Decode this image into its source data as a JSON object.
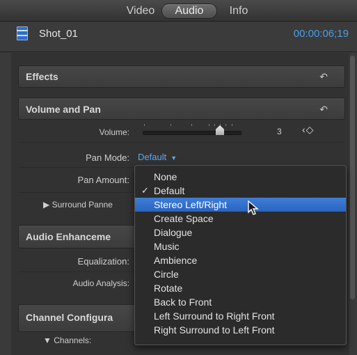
{
  "tabs": [
    {
      "label": "Video"
    },
    {
      "label": "Audio"
    },
    {
      "label": "Info"
    }
  ],
  "header": {
    "clip_name": "Shot_01",
    "timecode": "00:00:06;19"
  },
  "sections": {
    "effects": {
      "title": "Effects"
    },
    "volume_pan": {
      "title": "Volume and Pan",
      "volume_label": "Volume:",
      "volume_value": "3",
      "pan_mode_label": "Pan Mode:",
      "pan_mode_value": "Default",
      "pan_amount_label": "Pan Amount:",
      "surround_label": "▶ Surround Panne"
    },
    "audio_enh": {
      "title": "Audio Enhanceme",
      "equalization_label": "Equalization:",
      "analysis_label": "Audio Analysis:"
    },
    "channel_config": {
      "title": "Channel Configura",
      "channels_label": "▼   Channels:"
    }
  },
  "pan_menu": {
    "items": [
      {
        "label": "None",
        "checked": false,
        "highlighted": false
      },
      {
        "label": "Default",
        "checked": true,
        "highlighted": false
      },
      {
        "label": "Stereo Left/Right",
        "checked": false,
        "highlighted": true
      },
      {
        "label": "Create Space",
        "checked": false,
        "highlighted": false
      },
      {
        "label": "Dialogue",
        "checked": false,
        "highlighted": false
      },
      {
        "label": "Music",
        "checked": false,
        "highlighted": false
      },
      {
        "label": "Ambience",
        "checked": false,
        "highlighted": false
      },
      {
        "label": "Circle",
        "checked": false,
        "highlighted": false
      },
      {
        "label": "Rotate",
        "checked": false,
        "highlighted": false
      },
      {
        "label": "Back to Front",
        "checked": false,
        "highlighted": false
      },
      {
        "label": "Left Surround to Right Front",
        "checked": false,
        "highlighted": false
      },
      {
        "label": "Right Surround to Left Front",
        "checked": false,
        "highlighted": false
      }
    ]
  },
  "colors": {
    "accent": "#4d9de8",
    "highlight": "#2f6dc9"
  }
}
